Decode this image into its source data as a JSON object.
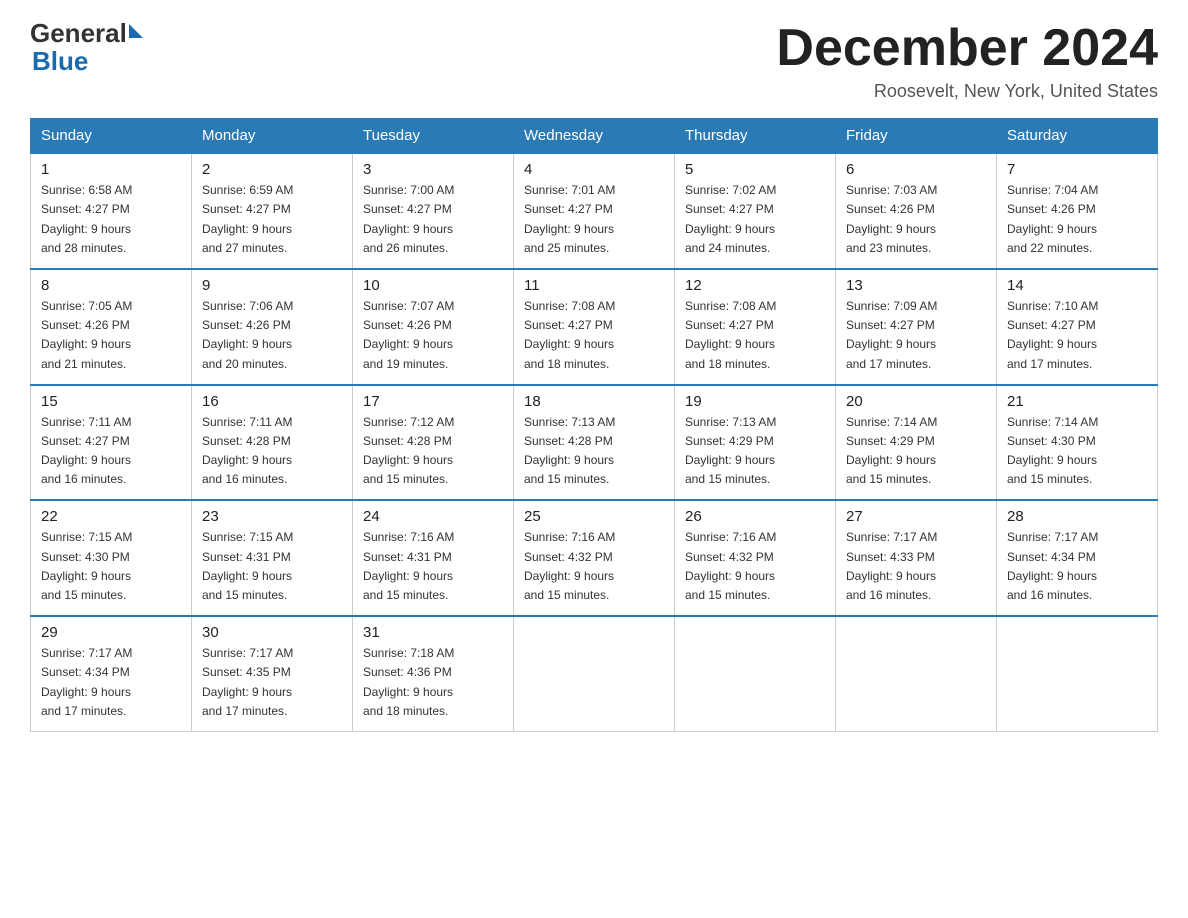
{
  "header": {
    "logo_general": "General",
    "logo_blue": "Blue",
    "month_title": "December 2024",
    "location": "Roosevelt, New York, United States"
  },
  "days_of_week": [
    "Sunday",
    "Monday",
    "Tuesday",
    "Wednesday",
    "Thursday",
    "Friday",
    "Saturday"
  ],
  "weeks": [
    [
      {
        "day": 1,
        "sunrise": "6:58 AM",
        "sunset": "4:27 PM",
        "daylight": "9 hours and 28 minutes."
      },
      {
        "day": 2,
        "sunrise": "6:59 AM",
        "sunset": "4:27 PM",
        "daylight": "9 hours and 27 minutes."
      },
      {
        "day": 3,
        "sunrise": "7:00 AM",
        "sunset": "4:27 PM",
        "daylight": "9 hours and 26 minutes."
      },
      {
        "day": 4,
        "sunrise": "7:01 AM",
        "sunset": "4:27 PM",
        "daylight": "9 hours and 25 minutes."
      },
      {
        "day": 5,
        "sunrise": "7:02 AM",
        "sunset": "4:27 PM",
        "daylight": "9 hours and 24 minutes."
      },
      {
        "day": 6,
        "sunrise": "7:03 AM",
        "sunset": "4:26 PM",
        "daylight": "9 hours and 23 minutes."
      },
      {
        "day": 7,
        "sunrise": "7:04 AM",
        "sunset": "4:26 PM",
        "daylight": "9 hours and 22 minutes."
      }
    ],
    [
      {
        "day": 8,
        "sunrise": "7:05 AM",
        "sunset": "4:26 PM",
        "daylight": "9 hours and 21 minutes."
      },
      {
        "day": 9,
        "sunrise": "7:06 AM",
        "sunset": "4:26 PM",
        "daylight": "9 hours and 20 minutes."
      },
      {
        "day": 10,
        "sunrise": "7:07 AM",
        "sunset": "4:26 PM",
        "daylight": "9 hours and 19 minutes."
      },
      {
        "day": 11,
        "sunrise": "7:08 AM",
        "sunset": "4:27 PM",
        "daylight": "9 hours and 18 minutes."
      },
      {
        "day": 12,
        "sunrise": "7:08 AM",
        "sunset": "4:27 PM",
        "daylight": "9 hours and 18 minutes."
      },
      {
        "day": 13,
        "sunrise": "7:09 AM",
        "sunset": "4:27 PM",
        "daylight": "9 hours and 17 minutes."
      },
      {
        "day": 14,
        "sunrise": "7:10 AM",
        "sunset": "4:27 PM",
        "daylight": "9 hours and 17 minutes."
      }
    ],
    [
      {
        "day": 15,
        "sunrise": "7:11 AM",
        "sunset": "4:27 PM",
        "daylight": "9 hours and 16 minutes."
      },
      {
        "day": 16,
        "sunrise": "7:11 AM",
        "sunset": "4:28 PM",
        "daylight": "9 hours and 16 minutes."
      },
      {
        "day": 17,
        "sunrise": "7:12 AM",
        "sunset": "4:28 PM",
        "daylight": "9 hours and 15 minutes."
      },
      {
        "day": 18,
        "sunrise": "7:13 AM",
        "sunset": "4:28 PM",
        "daylight": "9 hours and 15 minutes."
      },
      {
        "day": 19,
        "sunrise": "7:13 AM",
        "sunset": "4:29 PM",
        "daylight": "9 hours and 15 minutes."
      },
      {
        "day": 20,
        "sunrise": "7:14 AM",
        "sunset": "4:29 PM",
        "daylight": "9 hours and 15 minutes."
      },
      {
        "day": 21,
        "sunrise": "7:14 AM",
        "sunset": "4:30 PM",
        "daylight": "9 hours and 15 minutes."
      }
    ],
    [
      {
        "day": 22,
        "sunrise": "7:15 AM",
        "sunset": "4:30 PM",
        "daylight": "9 hours and 15 minutes."
      },
      {
        "day": 23,
        "sunrise": "7:15 AM",
        "sunset": "4:31 PM",
        "daylight": "9 hours and 15 minutes."
      },
      {
        "day": 24,
        "sunrise": "7:16 AM",
        "sunset": "4:31 PM",
        "daylight": "9 hours and 15 minutes."
      },
      {
        "day": 25,
        "sunrise": "7:16 AM",
        "sunset": "4:32 PM",
        "daylight": "9 hours and 15 minutes."
      },
      {
        "day": 26,
        "sunrise": "7:16 AM",
        "sunset": "4:32 PM",
        "daylight": "9 hours and 15 minutes."
      },
      {
        "day": 27,
        "sunrise": "7:17 AM",
        "sunset": "4:33 PM",
        "daylight": "9 hours and 16 minutes."
      },
      {
        "day": 28,
        "sunrise": "7:17 AM",
        "sunset": "4:34 PM",
        "daylight": "9 hours and 16 minutes."
      }
    ],
    [
      {
        "day": 29,
        "sunrise": "7:17 AM",
        "sunset": "4:34 PM",
        "daylight": "9 hours and 17 minutes."
      },
      {
        "day": 30,
        "sunrise": "7:17 AM",
        "sunset": "4:35 PM",
        "daylight": "9 hours and 17 minutes."
      },
      {
        "day": 31,
        "sunrise": "7:18 AM",
        "sunset": "4:36 PM",
        "daylight": "9 hours and 18 minutes."
      },
      null,
      null,
      null,
      null
    ]
  ],
  "labels": {
    "sunrise": "Sunrise:",
    "sunset": "Sunset:",
    "daylight": "Daylight:"
  }
}
